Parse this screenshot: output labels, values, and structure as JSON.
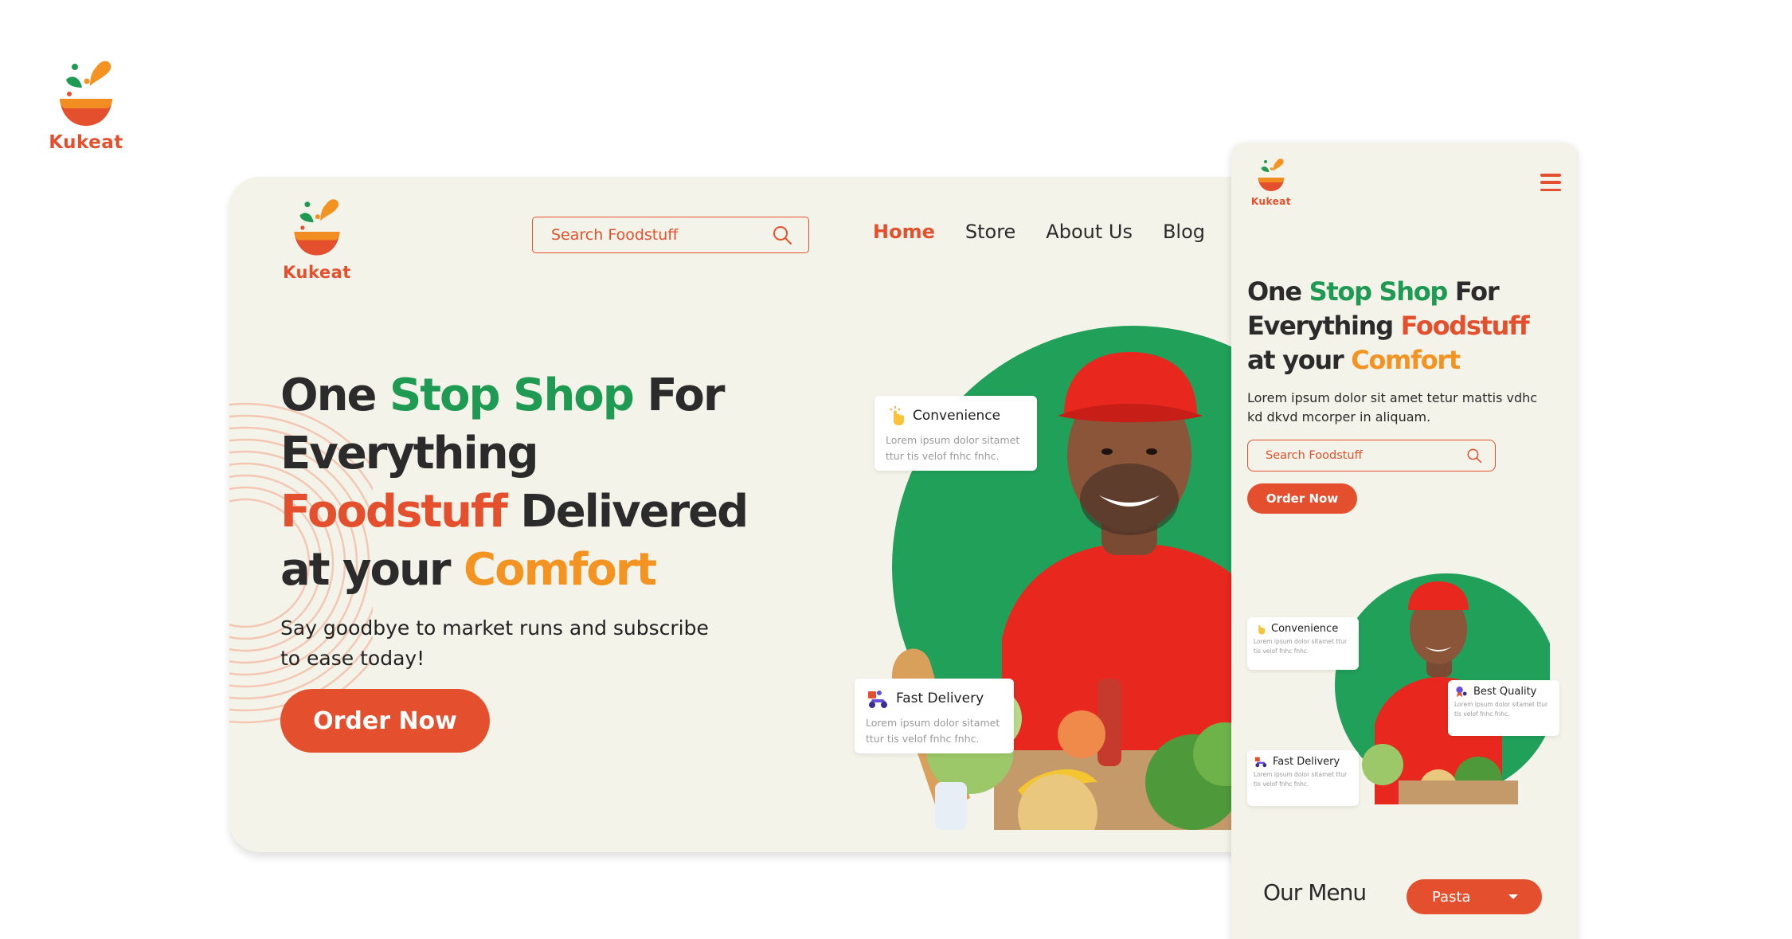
{
  "brand": {
    "name": "Kukeat"
  },
  "desktop": {
    "search": {
      "placeholder": "Search Foodstuff"
    },
    "nav": [
      {
        "label": "Home",
        "active": true
      },
      {
        "label": "Store"
      },
      {
        "label": "About Us"
      },
      {
        "label": "Blog"
      }
    ],
    "hero": {
      "title": {
        "w1": "One ",
        "w2": "Stop Shop",
        "w3": " For ",
        "w4": "Everything ",
        "w5": "Foodstuff",
        "w6": " Delivered at your ",
        "w7": "Comfort"
      },
      "subtitle": "Say goodbye to market runs and subscribe to ease today!",
      "cta": "Order Now"
    },
    "features": [
      {
        "title": "Convenience",
        "desc": "Lorem ipsum dolor sitamet ttur tis velof fnhc fnhc."
      },
      {
        "title": "Fast Delivery",
        "desc": "Lorem ipsum dolor sitamet ttur tis velof fnhc fnhc."
      }
    ]
  },
  "mobile": {
    "hero": {
      "title": {
        "w1": "One ",
        "w2": "Stop Shop",
        "w3": " For Everything ",
        "w4": "Foodstuff",
        "w5": " at your ",
        "w6": "Comfort"
      },
      "subtitle": "Lorem ipsum dolor sit amet tetur mattis vdhc kd dkvd mcorper in aliquam.",
      "search_placeholder": "Search Foodstuff",
      "cta": "Order Now"
    },
    "features": [
      {
        "title": "Convenience",
        "desc": "Lorem ipsum dolor sitamet ttur tis velof fnhc fnhc."
      },
      {
        "title": "Best Quality",
        "desc": "Lorem ipsum dolor sitamet ttur tis velof fnhc fnhc."
      },
      {
        "title": "Fast Delivery",
        "desc": "Lorem ipsum dolor sitamet ttur tis velof fnhc fnhc."
      }
    ],
    "menu": {
      "title": "Our Menu",
      "selected": "Pasta"
    }
  },
  "colors": {
    "accent": "#E4502E",
    "green": "#1F9A52",
    "orange": "#F39321",
    "background": "#F3F3E9"
  },
  "icons": [
    "bowl-logo-icon",
    "search-icon",
    "hamburger-icon",
    "tap-hand-icon",
    "delivery-scooter-icon",
    "quality-badge-icon",
    "caret-down-icon"
  ]
}
